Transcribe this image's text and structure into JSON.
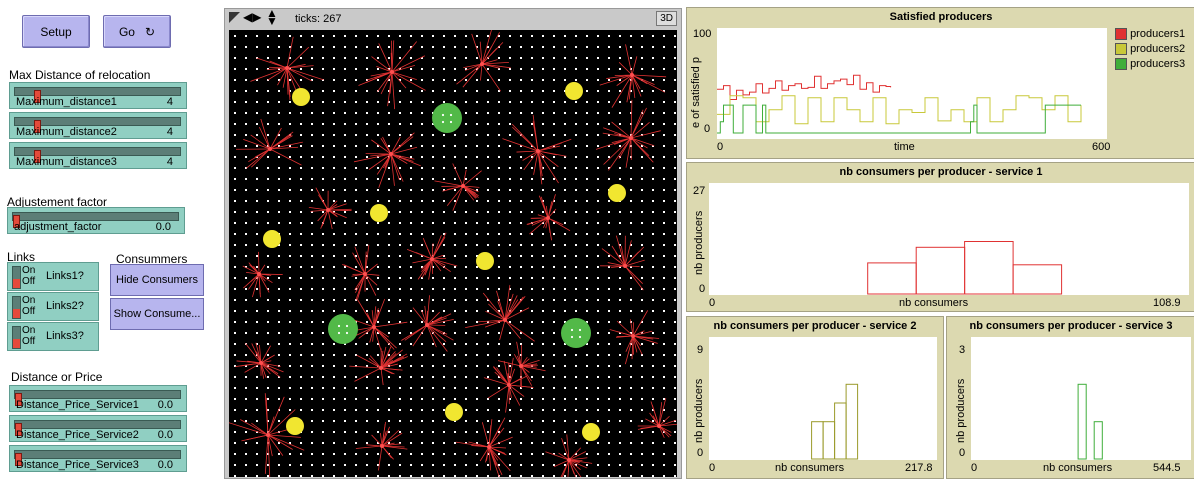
{
  "buttons": {
    "setup": "Setup",
    "go": "Go"
  },
  "headings": {
    "max_distance": "Max Distance of relocation",
    "adjustment": "Adjustement factor",
    "links": "Links",
    "consumers": "Consummers",
    "distance_price": "Distance or Price"
  },
  "sliders": [
    {
      "name": "Maximum_distance1",
      "value": "4",
      "level": 0.12
    },
    {
      "name": "Maximum_distance2",
      "value": "4",
      "level": 0.12
    },
    {
      "name": "Maximum_distance3",
      "value": "4",
      "level": 0.12
    },
    {
      "name": "adjustment_factor",
      "value": "0.0",
      "level": 0.0
    },
    {
      "name": "Distance_Price_Service1",
      "value": "0.0",
      "level": 0.0
    },
    {
      "name": "Distance_Price_Service2",
      "value": "0.0",
      "level": 0.0
    },
    {
      "name": "Distance_Price_Service3",
      "value": "0.0",
      "level": 0.0
    }
  ],
  "switches": [
    {
      "on": "On",
      "off": "Off",
      "name": "Links1?"
    },
    {
      "on": "On",
      "off": "Off",
      "name": "Links2?"
    },
    {
      "on": "On",
      "off": "Off",
      "name": "Links3?"
    }
  ],
  "consumer_buttons": {
    "hide": "Hide Consumers",
    "show": "Show Consume..."
  },
  "world": {
    "ticks": "ticks: 267",
    "three_d": "3D"
  },
  "colors": {
    "producers1": "#e03232",
    "producers2": "#c8c83a",
    "producers3": "#3fae3a",
    "yellow": "#f1e630",
    "green": "#52b948"
  },
  "chart_data": [
    {
      "type": "line",
      "title": "Satisfied producers",
      "xlabel": "time",
      "ylabel": "e of satisfied p",
      "xlim": [
        0,
        600
      ],
      "ylim": [
        0,
        100
      ],
      "x_ticks": [
        "0",
        "600"
      ],
      "y_ticks": [
        "100",
        "0"
      ],
      "legend": "top-right",
      "series": [
        {
          "name": "producers1",
          "color": "#e03232",
          "x": [
            0,
            10,
            20,
            30,
            40,
            50,
            60,
            70,
            80,
            90,
            100,
            110,
            120,
            130,
            140,
            150,
            160,
            170,
            180,
            190,
            200,
            210,
            220,
            230,
            240,
            250,
            260,
            267
          ],
          "y": [
            47,
            51,
            36,
            46,
            41,
            44,
            53,
            43,
            48,
            56,
            46,
            51,
            53,
            48,
            49,
            61,
            48,
            53,
            56,
            58,
            52,
            62,
            47,
            54,
            44,
            51,
            50,
            49
          ]
        },
        {
          "name": "producers2",
          "color": "#c8c83a",
          "x": [
            0,
            20,
            40,
            60,
            80,
            100,
            120,
            140,
            160,
            180,
            200,
            220,
            240,
            260,
            280,
            300,
            320,
            340,
            360,
            380,
            400,
            420,
            440,
            460,
            480,
            500,
            520,
            540,
            560
          ],
          "y": [
            20,
            40,
            38,
            12,
            25,
            40,
            10,
            38,
            12,
            38,
            25,
            12,
            38,
            10,
            25,
            22,
            38,
            13,
            25,
            12,
            38,
            12,
            25,
            40,
            38,
            25,
            40,
            12,
            30
          ]
        },
        {
          "name": "producers3",
          "color": "#3fae3a",
          "x": [
            0,
            5,
            10,
            15,
            20,
            25,
            30,
            35,
            40,
            45,
            55,
            60,
            65,
            70,
            75,
            100,
            120,
            140,
            160,
            180,
            200,
            220,
            240,
            260,
            280,
            380,
            385,
            390,
            395,
            400,
            440,
            500,
            505,
            510,
            515,
            520,
            560
          ],
          "y": [
            0,
            12,
            30,
            30,
            30,
            0,
            0,
            0,
            30,
            30,
            30,
            0,
            0,
            30,
            0,
            0,
            0,
            0,
            0,
            0,
            0,
            0,
            0,
            0,
            0,
            0,
            0,
            12,
            30,
            0,
            0,
            0,
            30,
            30,
            30,
            30,
            30
          ]
        }
      ]
    },
    {
      "type": "bar",
      "title": "nb consumers per producer - service 1",
      "xlabel": "nb consumers",
      "ylabel": "nb producers",
      "xlim": [
        0,
        108.9
      ],
      "ylim": [
        0,
        27
      ],
      "x_ticks": [
        "0",
        "108.9"
      ],
      "y_ticks": [
        "27",
        "0"
      ],
      "color": "#e03232",
      "bins": [
        {
          "x0": 36,
          "x1": 47,
          "value": 8
        },
        {
          "x0": 47,
          "x1": 58,
          "value": 12
        },
        {
          "x0": 58,
          "x1": 69,
          "value": 13.5
        },
        {
          "x0": 69,
          "x1": 80,
          "value": 7.5
        }
      ]
    },
    {
      "type": "bar",
      "title": "nb consumers per producer - service 2",
      "xlabel": "nb consumers",
      "ylabel": "nb producers",
      "xlim": [
        0,
        217.8
      ],
      "ylim": [
        0,
        9
      ],
      "x_ticks": [
        "0",
        "217.8"
      ],
      "y_ticks": [
        "9",
        "0"
      ],
      "color": "#9a9a2a",
      "bins": [
        {
          "x0": 98,
          "x1": 109,
          "value": 3
        },
        {
          "x0": 109,
          "x1": 120,
          "value": 3
        },
        {
          "x0": 120,
          "x1": 131,
          "value": 4.5
        },
        {
          "x0": 131,
          "x1": 142,
          "value": 6
        }
      ]
    },
    {
      "type": "bar",
      "title": "nb consumers per producer - service 3",
      "xlabel": "nb consumers",
      "ylabel": "nb producers",
      "xlim": [
        0,
        544.5
      ],
      "ylim": [
        0,
        3
      ],
      "x_ticks": [
        "0",
        "544.5"
      ],
      "y_ticks": [
        "3",
        "0"
      ],
      "color": "#3fae3a",
      "bins": [
        {
          "x0": 265,
          "x1": 285,
          "value": 2
        },
        {
          "x0": 305,
          "x1": 325,
          "value": 1
        }
      ]
    }
  ]
}
